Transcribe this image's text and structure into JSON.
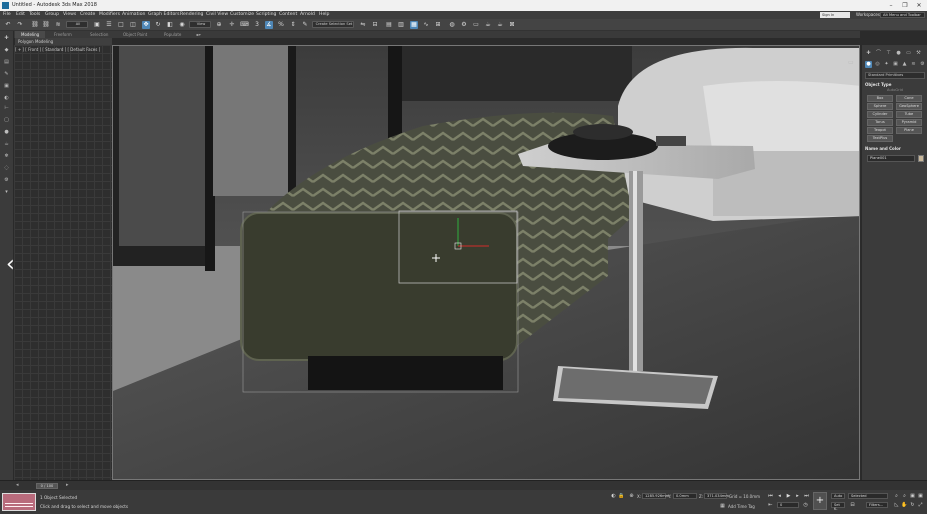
{
  "titlebar": {
    "title": "Untitled - Autodesk 3ds Max 2018",
    "minimize": "–",
    "maximize": "❐",
    "close": "✕"
  },
  "menubar": {
    "items": [
      "File",
      "Edit",
      "Tools",
      "Group",
      "Views",
      "Create",
      "Modifiers",
      "Animation",
      "Graph Editors",
      "Rendering",
      "Civil View",
      "Customize",
      "Scripting",
      "Content",
      "Arnold",
      "Help"
    ],
    "sign_in": "Sign In",
    "workspaces_label": "Workspaces:",
    "workspace_value": "Alt Menu and Toolbar"
  },
  "toolbar": {
    "filter_value": "All",
    "coord_value": "View",
    "selection_set": "Create Selection Set"
  },
  "ribbon": {
    "tabs": [
      {
        "label": "Modeling",
        "active": true
      },
      {
        "label": "Freeform",
        "active": false
      },
      {
        "label": "Selection",
        "active": false
      },
      {
        "label": "Object Paint",
        "active": false
      },
      {
        "label": "Populate",
        "active": false
      }
    ],
    "sub_label": "Polygon Modeling"
  },
  "viewport": {
    "label": "[ + ] [ Front ] [ Standard ] [ Default Faces ]"
  },
  "right_panel": {
    "category": "Standard Primitives",
    "object_type_title": "Object Type",
    "autogrid": "AutoGrid",
    "buttons": [
      "Box",
      "Cone",
      "Sphere",
      "GeoSphere",
      "Cylinder",
      "Tube",
      "Torus",
      "Pyramid",
      "Teapot",
      "Plane",
      "TextPlus"
    ],
    "name_color_title": "Name and Color",
    "name_value": "Plane001"
  },
  "timeline": {
    "frame": "0 / 100"
  },
  "status": {
    "selection": "1 Object Selected",
    "prompt": "Click and drag to select and move objects",
    "x_label": "X:",
    "x_value": "1285.926mm",
    "y_label": "Y:",
    "y_value": "0.0mm",
    "z_label": "Z:",
    "z_value": "371.034mm",
    "grid": "Grid = 10.0mm",
    "add_time_tag": "Add Time Tag",
    "auto": "Auto",
    "set_key": "Set K.",
    "selected": "Selected",
    "filters": "Filters...",
    "frame_value": "0"
  },
  "colors": {
    "accent": "#4f87b6",
    "viewport_border": "#777777",
    "selection_box": "#9a9a9a",
    "gizmo_y": "#2fae3d",
    "gizmo_x": "#d22b2b"
  }
}
